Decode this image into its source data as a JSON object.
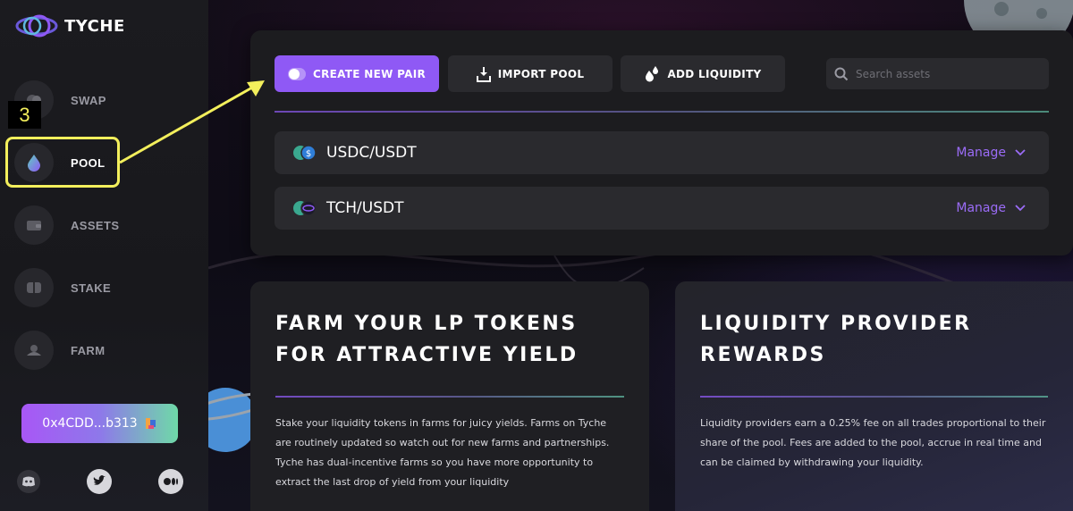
{
  "app": {
    "name": "TYCHE"
  },
  "sidebar": {
    "items": [
      {
        "label": "SWAP",
        "icon": "swap-icon"
      },
      {
        "label": "POOL",
        "icon": "droplet-icon",
        "active": true
      },
      {
        "label": "ASSETS",
        "icon": "wallet-icon"
      },
      {
        "label": "STAKE",
        "icon": "stake-icon"
      },
      {
        "label": "FARM",
        "icon": "farm-icon"
      }
    ],
    "wallet_address": "0x4CDD...b313",
    "social": [
      "discord-icon",
      "twitter-icon",
      "medium-icon"
    ]
  },
  "annotation": {
    "step": "3"
  },
  "toolbar": {
    "create_label": "CREATE NEW PAIR",
    "import_label": "IMPORT POOL",
    "add_label": "ADD LIQUIDITY",
    "search_placeholder": "Search assets"
  },
  "pools": [
    {
      "pair": "USDC/USDT",
      "action": "Manage"
    },
    {
      "pair": "TCH/USDT",
      "action": "Manage"
    }
  ],
  "cards": {
    "farm": {
      "title_line1": "FARM YOUR LP TOKENS",
      "title_line2": "FOR ATTRACTIVE YIELD",
      "text": "Stake your liquidity tokens in farms for juicy yields. Farms on Tyche are routinely updated so watch out for new farms and partnerships. Tyche has dual-incentive farms so you have more opportunity to extract the last drop of yield from your liquidity"
    },
    "rewards": {
      "title_line1": "LIQUIDITY PROVIDER",
      "title_line2": "REWARDS",
      "text": "Liquidity providers earn a 0.25% fee on all trades proportional to their share of the pool. Fees are added to the pool, accrue in real time and can be claimed by withdrawing your liquidity."
    }
  },
  "colors": {
    "accent": "#8f59f5",
    "highlight": "#f3ef5c",
    "panel": "#1c1c1f"
  }
}
